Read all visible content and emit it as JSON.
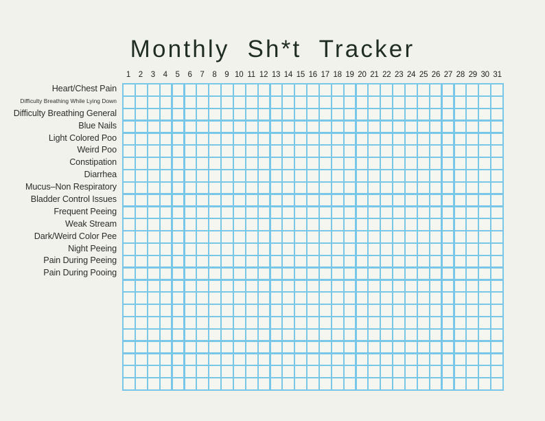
{
  "page": {
    "title": "Monthly  Sh*t  Tracker",
    "background_color": "#f2f2ec",
    "title_color": "#1f2d22",
    "label_color": "#2b2b2b",
    "grid_line_color": "#79c7e8",
    "cell_fill_color": "#f6f6f1"
  },
  "tracker": {
    "day_columns": [
      "1",
      "2",
      "3",
      "4",
      "5",
      "6",
      "7",
      "8",
      "9",
      "10",
      "11",
      "12",
      "13",
      "14",
      "15",
      "16",
      "17",
      "18",
      "19",
      "20",
      "21",
      "22",
      "23",
      "24",
      "25",
      "26",
      "27",
      "28",
      "29",
      "30",
      "31"
    ],
    "column_count": 31,
    "row_count": 25,
    "rows": [
      {
        "label": "Heart/Chest Pain",
        "size": "normal"
      },
      {
        "label": "Difficulty Breathing While Lying Down",
        "size": "small"
      },
      {
        "label": "Difficulty Breathing General",
        "size": "normal"
      },
      {
        "label": "Blue Nails",
        "size": "normal"
      },
      {
        "label": "Light Colored Poo",
        "size": "normal"
      },
      {
        "label": "Weird Poo",
        "size": "normal"
      },
      {
        "label": "Constipation",
        "size": "normal"
      },
      {
        "label": "Diarrhea",
        "size": "normal"
      },
      {
        "label": "Mucus–Non Respiratory",
        "size": "normal"
      },
      {
        "label": "Bladder Control Issues",
        "size": "normal"
      },
      {
        "label": "Frequent Peeing",
        "size": "normal"
      },
      {
        "label": "Weak Stream",
        "size": "normal"
      },
      {
        "label": "Dark/Weird Color Pee",
        "size": "normal"
      },
      {
        "label": "Night Peeing",
        "size": "normal"
      },
      {
        "label": "Pain During Peeing",
        "size": "normal"
      },
      {
        "label": "Pain During Pooing",
        "size": "normal"
      },
      {
        "label": "",
        "size": "normal"
      },
      {
        "label": "",
        "size": "normal"
      },
      {
        "label": "",
        "size": "normal"
      },
      {
        "label": "",
        "size": "normal"
      },
      {
        "label": "",
        "size": "normal"
      },
      {
        "label": "",
        "size": "normal"
      },
      {
        "label": "",
        "size": "normal"
      },
      {
        "label": "",
        "size": "normal"
      },
      {
        "label": "",
        "size": "normal"
      }
    ]
  }
}
